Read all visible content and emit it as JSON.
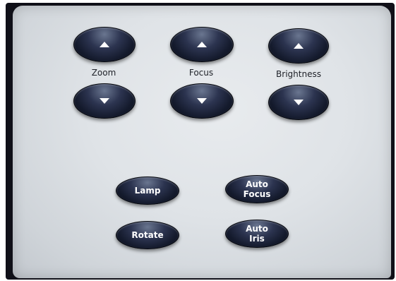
{
  "controls": {
    "zoom": {
      "label": "Zoom"
    },
    "focus": {
      "label": "Focus"
    },
    "brightness": {
      "label": "Brightness"
    }
  },
  "buttons": {
    "lamp": {
      "label": "Lamp"
    },
    "auto_focus": {
      "line1": "Auto",
      "line2": "Focus"
    },
    "rotate": {
      "label": "Rotate"
    },
    "auto_iris": {
      "line1": "Auto",
      "line2": "Iris"
    }
  },
  "icons": {
    "up": "arrow-up-icon",
    "down": "arrow-down-icon"
  },
  "colors": {
    "screen": "#dfe3e7",
    "button": "#141a2c",
    "button_text": "#ffffff",
    "label_text": "#20232a"
  }
}
